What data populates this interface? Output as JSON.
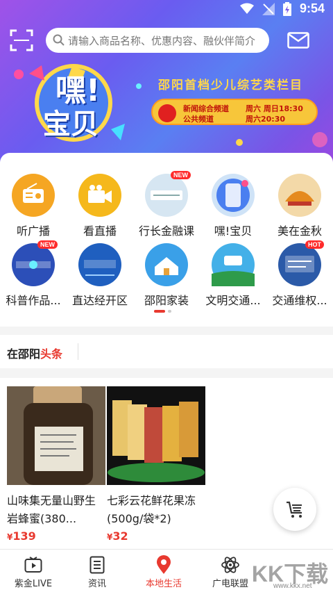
{
  "status_bar": {
    "time": "9:54"
  },
  "header": {
    "search_placeholder": "请输入商品名称、优惠内容、融伙伴简介"
  },
  "banner": {
    "art_text_top": "嘿!",
    "art_text_bottom": "宝贝",
    "show_title": "邵阳首档少儿综艺类栏目",
    "schedule": [
      {
        "channel": "新闻综合频道",
        "time": "周六 周日18:30"
      },
      {
        "channel": "公共频道",
        "time": "周六20:30"
      }
    ]
  },
  "categories": [
    {
      "label": "听广播",
      "icon": "radio-icon",
      "color": "#f5a623"
    },
    {
      "label": "看直播",
      "icon": "video-camera-icon",
      "color": "#f5b81c"
    },
    {
      "label": "行长金融课",
      "icon": "finance-course-icon",
      "color": "#d6e6f2",
      "badge": "NEW"
    },
    {
      "label": "嘿!宝贝",
      "icon": "hey-baby-icon",
      "color": "#cfe3f7"
    },
    {
      "label": "美在金秋",
      "icon": "golden-autumn-icon",
      "color": "#f3d9a8"
    },
    {
      "label": "科普作品...",
      "icon": "science-works-icon",
      "color": "#2c4fb8",
      "badge": "NEW"
    },
    {
      "label": "直达经开区",
      "icon": "dev-zone-icon",
      "color": "#1f5fbf"
    },
    {
      "label": "邵阳家装",
      "icon": "home-decor-icon",
      "color": "#3aa0e8"
    },
    {
      "label": "文明交通...",
      "icon": "civil-traffic-icon",
      "color": "#43b0e8"
    },
    {
      "label": "交通维权...",
      "icon": "traffic-rights-icon",
      "color": "#2b5aa8",
      "badge": "HOT"
    }
  ],
  "headline": {
    "prefix": "在邵阳",
    "highlight": "头条"
  },
  "products": [
    {
      "name": "山味集无量山野生岩蜂蜜(380...",
      "currency": "¥",
      "price": "139"
    },
    {
      "name": "七彩云花鲜花果冻(500g/袋*2)",
      "currency": "¥",
      "price": "32"
    }
  ],
  "bottom_nav": [
    {
      "label": "紫金LIVE",
      "icon": "tv-play-icon"
    },
    {
      "label": "资讯",
      "icon": "news-list-icon"
    },
    {
      "label": "本地生活",
      "icon": "location-pin-icon",
      "active": true
    },
    {
      "label": "广电联盟",
      "icon": "atom-icon"
    }
  ],
  "watermark": {
    "text": "KK下载",
    "url": "www.kkx.net"
  },
  "colors": {
    "accent": "#e8392f",
    "banner_start": "#a052e8",
    "banner_end": "#5a7ff2"
  }
}
